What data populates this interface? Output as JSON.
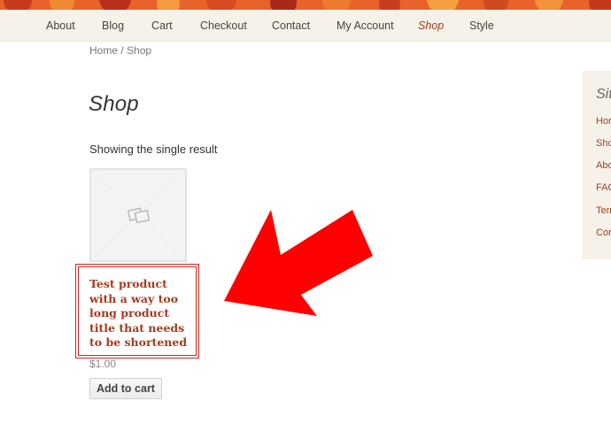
{
  "nav": {
    "items": [
      {
        "label": "About"
      },
      {
        "label": "Blog"
      },
      {
        "label": "Cart"
      },
      {
        "label": "Checkout"
      },
      {
        "label": "Contact"
      },
      {
        "label": "My Account"
      },
      {
        "label": "Shop",
        "active": true
      },
      {
        "label": "Style"
      }
    ]
  },
  "breadcrumb": {
    "home": "Home",
    "separator": " / ",
    "current": "Shop"
  },
  "page": {
    "title": "Shop",
    "result_count": "Showing the single result"
  },
  "product": {
    "image_icon": "placeholder-image-icon",
    "title": "Test product with a way too long product title that needs to be shortened",
    "price": "$1.00",
    "add_to_cart_label": "Add to cart"
  },
  "sidebar": {
    "title": "Site",
    "items": [
      {
        "label": "Home"
      },
      {
        "label": "Shop"
      },
      {
        "label": "About"
      },
      {
        "label": "FAQ"
      },
      {
        "label": "Terms"
      },
      {
        "label": "Contact"
      }
    ]
  },
  "colors": {
    "accent": "#a33c20",
    "nav_bg": "#f6f2ea",
    "annotation_red": "#ff0000",
    "highlight_border": "#d62424"
  }
}
